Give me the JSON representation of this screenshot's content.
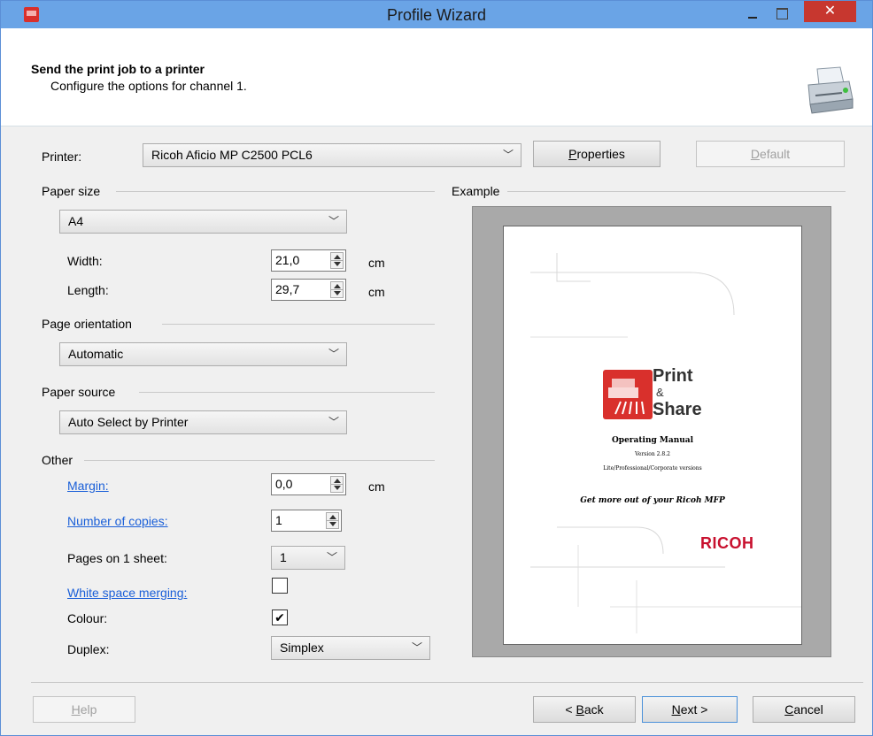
{
  "window": {
    "title": "Profile Wizard",
    "close_glyph": "✕"
  },
  "header": {
    "title": "Send the print job to a printer",
    "subtitle": "Configure the options for channel 1."
  },
  "printer": {
    "label": "Printer:",
    "value": "Ricoh Aficio MP C2500 PCL6",
    "properties_label": "Properties",
    "properties_access": "P",
    "properties_rest": "roperties",
    "default_access": "D",
    "default_rest": "efault"
  },
  "paper_size": {
    "group": "Paper size",
    "value": "A4",
    "width_label": "Width:",
    "width_value": "21,0",
    "length_label": "Length:",
    "length_value": "29,7",
    "unit": "cm"
  },
  "orientation": {
    "group": "Page orientation",
    "value": "Automatic"
  },
  "paper_source": {
    "group": "Paper source",
    "value": "Auto Select by Printer"
  },
  "other": {
    "group": "Other",
    "margin_label": "Margin:",
    "margin_value": "0,0",
    "copies_label": "Number of copies:",
    "copies_value": "1",
    "pages_label": "Pages on 1 sheet:",
    "pages_value": "1",
    "whitespace_label": "White space merging:",
    "whitespace_checked": false,
    "colour_label": "Colour:",
    "colour_mark": "✔",
    "colour_checked": true,
    "duplex_label": "Duplex:",
    "duplex_value": "Simplex"
  },
  "example": {
    "group": "Example",
    "logo_print": "Print",
    "logo_amp": "&",
    "logo_share": "Share",
    "doc_title": "Operating Manual",
    "doc_version": "Version 2.8.2",
    "doc_editions": "Lite/Professional/Corporate versions",
    "doc_tagline": "Get more out of your Ricoh MFP",
    "brand": "RICOH"
  },
  "footer": {
    "help_access": "H",
    "help_rest": "elp",
    "back_prefix": "< ",
    "back_access": "B",
    "back_rest": "ack",
    "next_access": "N",
    "next_rest": "ext >",
    "cancel_access": "C",
    "cancel_rest": "ancel"
  },
  "colors": {
    "titlebar": "#6aa4e6",
    "close": "#c7372f",
    "link": "#1a5fd8",
    "brand_red": "#c8102e"
  }
}
